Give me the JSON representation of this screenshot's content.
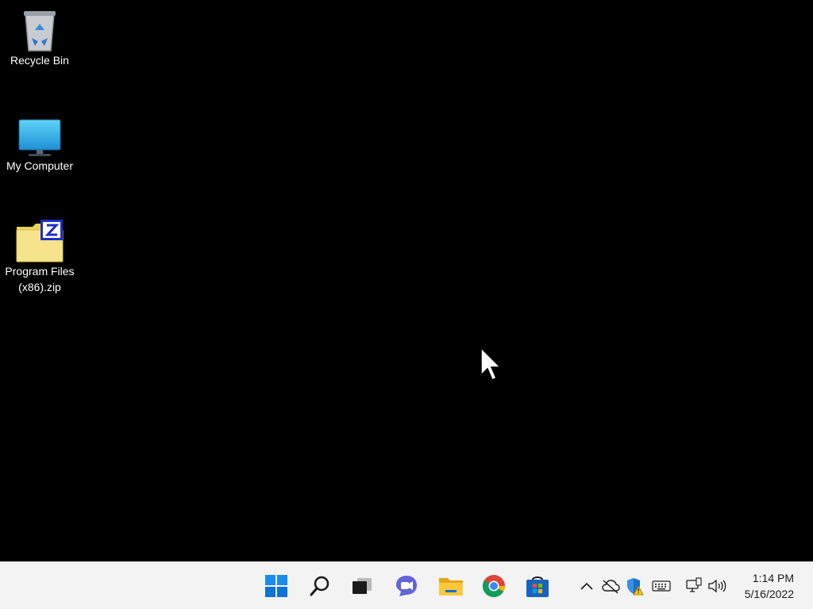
{
  "desktop": {
    "icons": [
      {
        "label": "Recycle Bin",
        "icon": "recycle-bin-icon"
      },
      {
        "label": "My Computer",
        "icon": "monitor-icon"
      },
      {
        "label": "Program Files (x86).zip",
        "icon": "zip-folder-icon"
      }
    ]
  },
  "taskbar": {
    "apps": [
      {
        "name": "Start",
        "icon": "windows-start-icon"
      },
      {
        "name": "Search",
        "icon": "search-icon"
      },
      {
        "name": "Task View",
        "icon": "task-view-icon"
      },
      {
        "name": "Chat",
        "icon": "teams-chat-icon"
      },
      {
        "name": "File Explorer",
        "icon": "file-explorer-icon"
      },
      {
        "name": "Google Chrome",
        "icon": "chrome-icon"
      },
      {
        "name": "Microsoft Store",
        "icon": "store-icon"
      }
    ],
    "tray": [
      {
        "name": "Show hidden icons",
        "icon": "chevron-up-icon"
      },
      {
        "name": "OneDrive",
        "icon": "onedrive-offline-icon"
      },
      {
        "name": "Windows Security",
        "icon": "security-shield-icon"
      },
      {
        "name": "Touch keyboard",
        "icon": "keyboard-icon"
      },
      {
        "name": "Network",
        "icon": "network-icon"
      },
      {
        "name": "Volume",
        "icon": "volume-icon"
      }
    ],
    "clock": {
      "time": "1:14 PM",
      "date": "5/16/2022"
    }
  },
  "colors": {
    "desktop_bg": "#000000",
    "taskbar_bg": "#f3f3f3",
    "accent": "#0078d4"
  }
}
